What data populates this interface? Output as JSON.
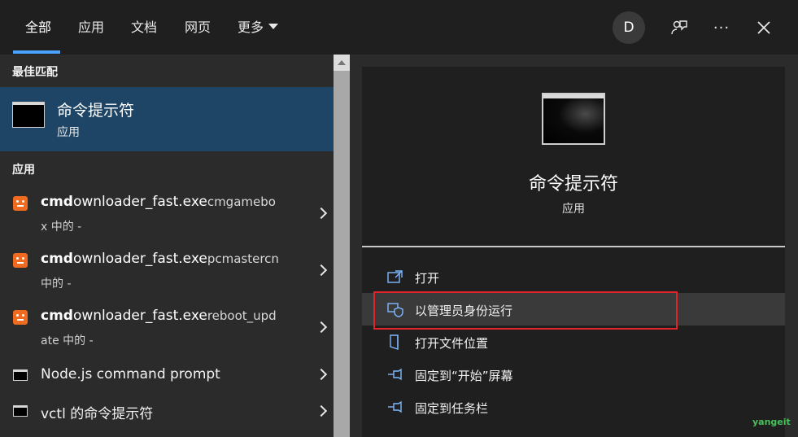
{
  "tabs": [
    {
      "label": "全部"
    },
    {
      "label": "应用"
    },
    {
      "label": "文档"
    },
    {
      "label": "网页"
    },
    {
      "label": "更多"
    }
  ],
  "header": {
    "avatar": "D",
    "more_options": "···"
  },
  "sections": {
    "best_match": "最佳匹配",
    "apps": "应用"
  },
  "best_match": {
    "title": "命令提示符",
    "subtitle": "应用"
  },
  "results": [
    {
      "bold": "cmd",
      "rest": "ownloader_fast.exe",
      "context": "cmgamebo",
      "line2": "x 中的 -"
    },
    {
      "bold": "cmd",
      "rest": "ownloader_fast.exe",
      "context": "pcmastercn",
      "line2": "中的 -"
    },
    {
      "bold": "cmd",
      "rest": "ownloader_fast.exe",
      "context": "reboot_upd",
      "line2": "ate 中的 -"
    },
    {
      "label": "Node.js command prompt"
    },
    {
      "label": "vctl 的命令提示符"
    }
  ],
  "detail": {
    "title": "命令提示符",
    "subtitle": "应用",
    "actions": [
      {
        "label": "打开",
        "icon": "open-window-icon"
      },
      {
        "label": "以管理员身份运行",
        "icon": "shield-icon"
      },
      {
        "label": "打开文件位置",
        "icon": "folder-icon"
      },
      {
        "label": "固定到“开始”屏幕",
        "icon": "pin-icon"
      },
      {
        "label": "固定到任务栏",
        "icon": "pin-icon"
      }
    ]
  },
  "watermark": "yangeit",
  "colors": {
    "accent": "#4aa3ff",
    "selected_row": "#1e4565",
    "highlight_box": "#e0242a"
  }
}
